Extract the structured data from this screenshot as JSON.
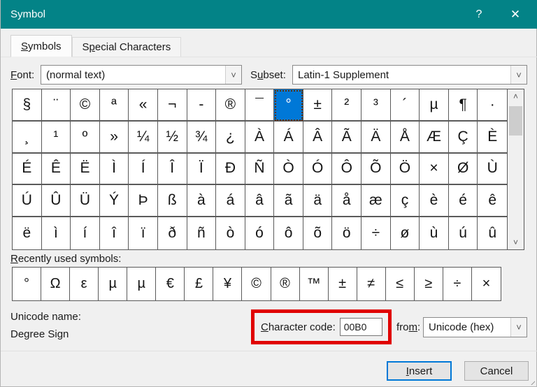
{
  "window": {
    "title": "Symbol",
    "help_icon": "?",
    "close_icon": "✕"
  },
  "tabs": [
    {
      "pre": "",
      "u": "S",
      "post": "ymbols",
      "active": true
    },
    {
      "pre": "S",
      "u": "p",
      "post": "ecial Characters",
      "active": false
    }
  ],
  "font_row": {
    "font_label": {
      "pre": "",
      "u": "F",
      "post": "ont:"
    },
    "font_value": "(normal text)",
    "subset_label": {
      "pre": "S",
      "u": "u",
      "post": "bset:"
    },
    "subset_value": "Latin-1 Supplement",
    "chevron_icon": "˅"
  },
  "grid": {
    "rows": [
      [
        "§",
        "¨",
        "©",
        "ª",
        "«",
        "¬",
        "-",
        "®",
        "¯",
        "°",
        "±",
        "²",
        "³",
        "´",
        "µ",
        "¶",
        "·"
      ],
      [
        "¸",
        "¹",
        "º",
        "»",
        "¼",
        "½",
        "¾",
        "¿",
        "À",
        "Á",
        "Â",
        "Ã",
        "Ä",
        "Å",
        "Æ",
        "Ç",
        "È"
      ],
      [
        "É",
        "Ê",
        "Ë",
        "Ì",
        "Í",
        "Î",
        "Ï",
        "Ð",
        "Ñ",
        "Ò",
        "Ó",
        "Ô",
        "Õ",
        "Ö",
        "×",
        "Ø",
        "Ù"
      ],
      [
        "Ú",
        "Û",
        "Ü",
        "Ý",
        "Þ",
        "ß",
        "à",
        "á",
        "â",
        "ã",
        "ä",
        "å",
        "æ",
        "ç",
        "è",
        "é",
        "ê"
      ],
      [
        "ë",
        "ì",
        "í",
        "î",
        "ï",
        "ð",
        "ñ",
        "ò",
        "ó",
        "ô",
        "õ",
        "ö",
        "÷",
        "ø",
        "ù",
        "ú",
        "û"
      ]
    ],
    "selected": {
      "row": 0,
      "col": 9,
      "char": "°"
    },
    "scroll_up_icon": "˄",
    "scroll_down_icon": "˅"
  },
  "recent": {
    "label": {
      "pre": "",
      "u": "R",
      "post": "ecently used symbols:"
    },
    "symbols": [
      "°",
      "Ω",
      "ε",
      "µ",
      "µ",
      "€",
      "£",
      "¥",
      "©",
      "®",
      "™",
      "±",
      "≠",
      "≤",
      "≥",
      "÷",
      "×"
    ]
  },
  "details": {
    "unicode_name_label": "Unicode name:",
    "unicode_name_value": "Degree Sign",
    "char_code_label": {
      "pre": "",
      "u": "C",
      "post": "haracter code:"
    },
    "char_code_value": "00B0",
    "from_label": {
      "pre": "fro",
      "u": "m",
      "post": ":"
    },
    "from_value": "Unicode (hex)",
    "chevron_icon": "˅"
  },
  "footer": {
    "insert_label": {
      "pre": "",
      "u": "I",
      "post": "nsert"
    },
    "cancel_label": "Cancel"
  },
  "colors": {
    "titlebar": "#038387",
    "selection_blue": "#0078D7",
    "annotation_red": "#E00000",
    "insert_border": "#0078D7"
  }
}
